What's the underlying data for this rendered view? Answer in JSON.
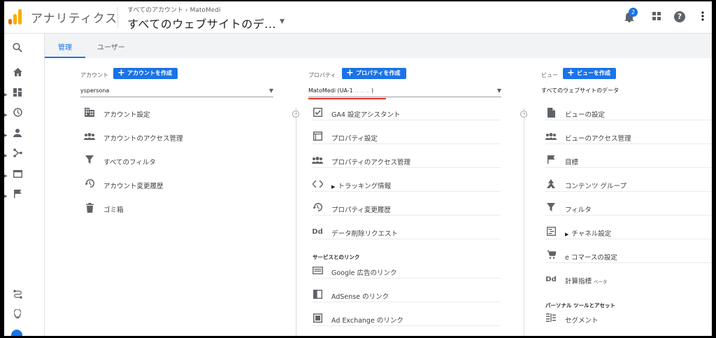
{
  "header": {
    "app_title": "アナリティクス",
    "breadcrumb_account": "すべてのアカウント",
    "breadcrumb_property": "MatoMedi",
    "view_title": "すべてのウェブサイトのデ...",
    "notification_count": "2",
    "icons": [
      "bell-icon",
      "apps-grid-icon",
      "help-icon",
      "more-vert-icon"
    ]
  },
  "rail": {
    "icons": [
      "search-icon",
      "home-icon",
      "dashboard-icon",
      "clock-icon",
      "person-icon",
      "share-icon",
      "window-icon",
      "flag-icon",
      "route-icon",
      "lightbulb-icon"
    ]
  },
  "tabs": [
    {
      "label": "管理"
    },
    {
      "label": "ユーザー"
    }
  ],
  "account": {
    "label": "アカウント",
    "create_button": "アカウントを作成",
    "selected": "yspersona",
    "items": [
      {
        "icon": "building-icon",
        "label": "アカウント設定"
      },
      {
        "icon": "people-icon",
        "label": "アカウントのアクセス管理"
      },
      {
        "icon": "filter-icon",
        "label": "すべてのフィルタ"
      },
      {
        "icon": "history-icon",
        "label": "アカウント変更履歴"
      },
      {
        "icon": "trash-icon",
        "label": "ゴミ箱"
      }
    ]
  },
  "property": {
    "label": "プロパティ",
    "create_button": "プロパティを作成",
    "selected": "MatoMedi (UA-1",
    "selected_suffix": ")",
    "items": [
      {
        "icon": "checkbox-icon",
        "label": "GA4 設定アシスタント"
      },
      {
        "icon": "square-icon",
        "label": "プロパティ設定"
      },
      {
        "icon": "people-icon",
        "label": "プロパティのアクセス管理"
      },
      {
        "icon": "code-icon",
        "label": "トラッキング情報"
      },
      {
        "icon": "history-icon",
        "label": "プロパティ変更履歴"
      },
      {
        "icon": "dd-icon",
        "label": "データ削除リクエスト"
      }
    ],
    "services_title": "サービスとのリンク",
    "services": [
      {
        "icon": "google-ads-icon",
        "label": "Google 広告のリンク"
      },
      {
        "icon": "adsense-icon",
        "label": "AdSense のリンク"
      },
      {
        "icon": "ad-exchange-icon",
        "label": "Ad Exchange のリンク"
      }
    ]
  },
  "view": {
    "label": "ビュー",
    "create_button": "ビューを作成",
    "selected": "すべてのウェブサイトのデータ",
    "items": [
      {
        "icon": "document-icon",
        "label": "ビューの設定"
      },
      {
        "icon": "people-icon",
        "label": "ビューのアクセス管理"
      },
      {
        "icon": "flag-icon",
        "label": "目標"
      },
      {
        "icon": "hierarchy-icon",
        "label": "コンテンツ グループ"
      },
      {
        "icon": "filter-icon",
        "label": "フィルタ"
      },
      {
        "icon": "channel-icon",
        "label": "チャネル設定"
      },
      {
        "icon": "cart-icon",
        "label": "e コマースの設定"
      },
      {
        "icon": "dd-icon",
        "label": "計算指標",
        "badge": "ベータ"
      }
    ],
    "personal_title": "パーソナル ツールとアセット",
    "personal_items": [
      {
        "icon": "segment-icon",
        "label": "セグメント"
      }
    ]
  },
  "colors": {
    "accent": "#1a73e8",
    "highlight_underline": "#d93025",
    "logo_orange": "#f9ab00",
    "logo_dark": "#e37400"
  }
}
